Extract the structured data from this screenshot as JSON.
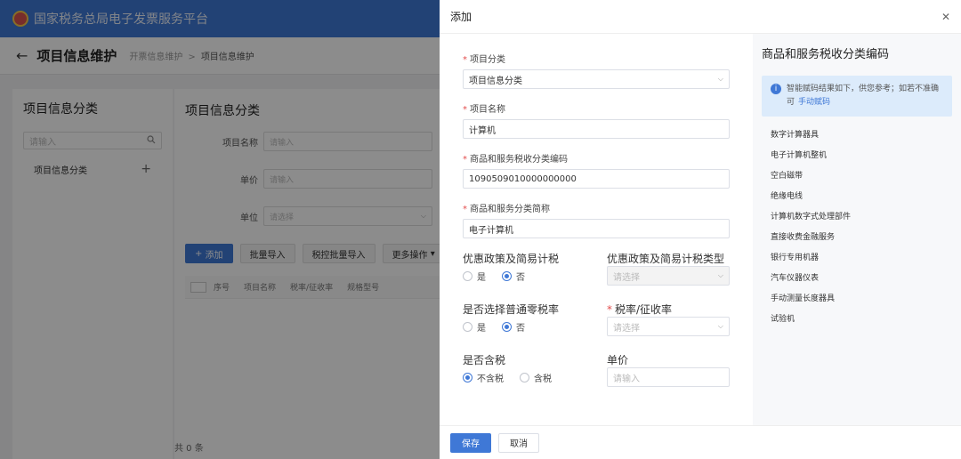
{
  "app": {
    "title": "国家税务总局电子发票服务平台"
  },
  "header": {
    "page_title": "项目信息维护",
    "breadcrumb": [
      "开票信息维护",
      "项目信息维护"
    ]
  },
  "left": {
    "title": "项目信息分类",
    "search_placeholder": "请输入",
    "tree_item": "项目信息分类"
  },
  "main": {
    "title": "项目信息分类",
    "fields": [
      {
        "label": "项目名称",
        "placeholder": "请输入"
      },
      {
        "label": "单价",
        "placeholder": "请输入"
      },
      {
        "label": "单位",
        "placeholder": "请选择"
      }
    ],
    "buttons": {
      "add": "添加",
      "batch_import": "批量导入",
      "tax_batch_import": "税控批量导入",
      "more": "更多操作"
    },
    "table_headers": [
      "序号",
      "项目名称",
      "税率/征收率",
      "规格型号"
    ],
    "total": "共 0 条"
  },
  "drawer": {
    "title": "添加",
    "fields": {
      "category": {
        "label": "项目分类",
        "value": "项目信息分类"
      },
      "name": {
        "label": "项目名称",
        "value": "计算机"
      },
      "tax_code": {
        "label": "商品和服务税收分类编码",
        "value": "1090509010000000000"
      },
      "short_name": {
        "label": "商品和服务分类简称",
        "value": "电子计算机"
      },
      "preferential": {
        "label": "优惠政策及简易计税",
        "options": [
          "是",
          "否"
        ],
        "selected": "否"
      },
      "preferential_type": {
        "label": "优惠政策及简易计税类型",
        "placeholder": "请选择"
      },
      "zero_rate": {
        "label": "是否选择普通零税率",
        "options": [
          "是",
          "否"
        ],
        "selected": "否"
      },
      "tax_rate": {
        "label": "税率/征收率",
        "placeholder": "请选择"
      },
      "tax_included": {
        "label": "是否含税",
        "options": [
          "不含税",
          "含税"
        ],
        "selected": "不含税"
      },
      "unit_price": {
        "label": "单价",
        "placeholder": "请输入"
      }
    },
    "code_panel": {
      "title": "商品和服务税收分类编码",
      "tip": "智能赋码结果如下，供您参考；如若不准确可",
      "tip_link": "手动赋码",
      "items": [
        "数字计算器具",
        "电子计算机整机",
        "空白磁带",
        "绝缘电线",
        "计算机数字式处理部件",
        "直接收费金融服务",
        "银行专用机器",
        "汽车仪器仪表",
        "手动测量长度器具",
        "试验机"
      ]
    },
    "footer": {
      "save": "保存",
      "cancel": "取消"
    }
  },
  "colors": {
    "brand": "#3f78d6",
    "required": "#e34d4d",
    "tip_bg": "#dcebfb"
  }
}
